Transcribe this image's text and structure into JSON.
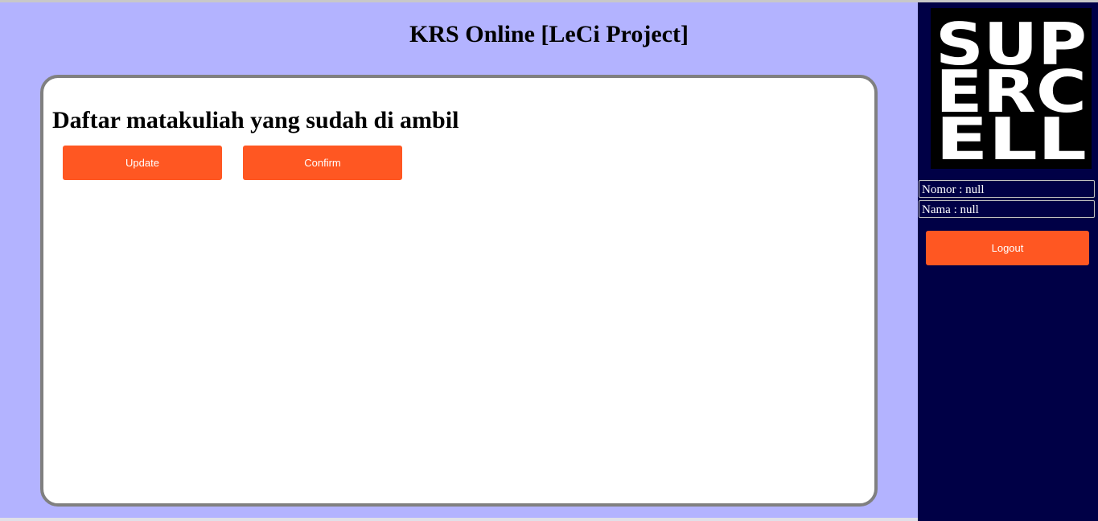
{
  "header": {
    "title": "KRS Online [LeCi Project]"
  },
  "main": {
    "heading": "Daftar matakuliah yang sudah di ambil",
    "update_label": "Update",
    "confirm_label": "Confirm"
  },
  "sidebar": {
    "logo": {
      "text": "SUPERCELL",
      "lines": [
        "SUP",
        "ERC",
        "ELL"
      ]
    },
    "nomor": "Nomor : null",
    "nama": "Nama : null",
    "logout_label": "Logout"
  },
  "colors": {
    "page_background": "#b3b3ff",
    "sidebar_background": "#000046",
    "button": "#ff5722",
    "panel_border": "#808080"
  }
}
